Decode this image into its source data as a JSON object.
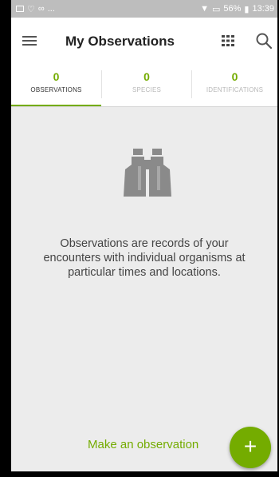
{
  "status_bar": {
    "left_text": "...",
    "battery": "56%",
    "time": "13:39"
  },
  "app_bar": {
    "title": "My Observations"
  },
  "tabs": [
    {
      "count": "0",
      "label": "OBSERVATIONS",
      "active": true
    },
    {
      "count": "0",
      "label": "SPECIES",
      "active": false
    },
    {
      "count": "0",
      "label": "IDENTIFICATIONS",
      "active": false
    }
  ],
  "empty_state": {
    "icon": "binoculars-icon",
    "message": "Observations are records of your encounters with individual organisms at particular times and locations."
  },
  "footer": {
    "cta_label": "Make an observation",
    "fab_symbol": "+"
  },
  "colors": {
    "accent": "#74ac00",
    "background": "#ececec",
    "status_bar": "#bdbdbd"
  }
}
